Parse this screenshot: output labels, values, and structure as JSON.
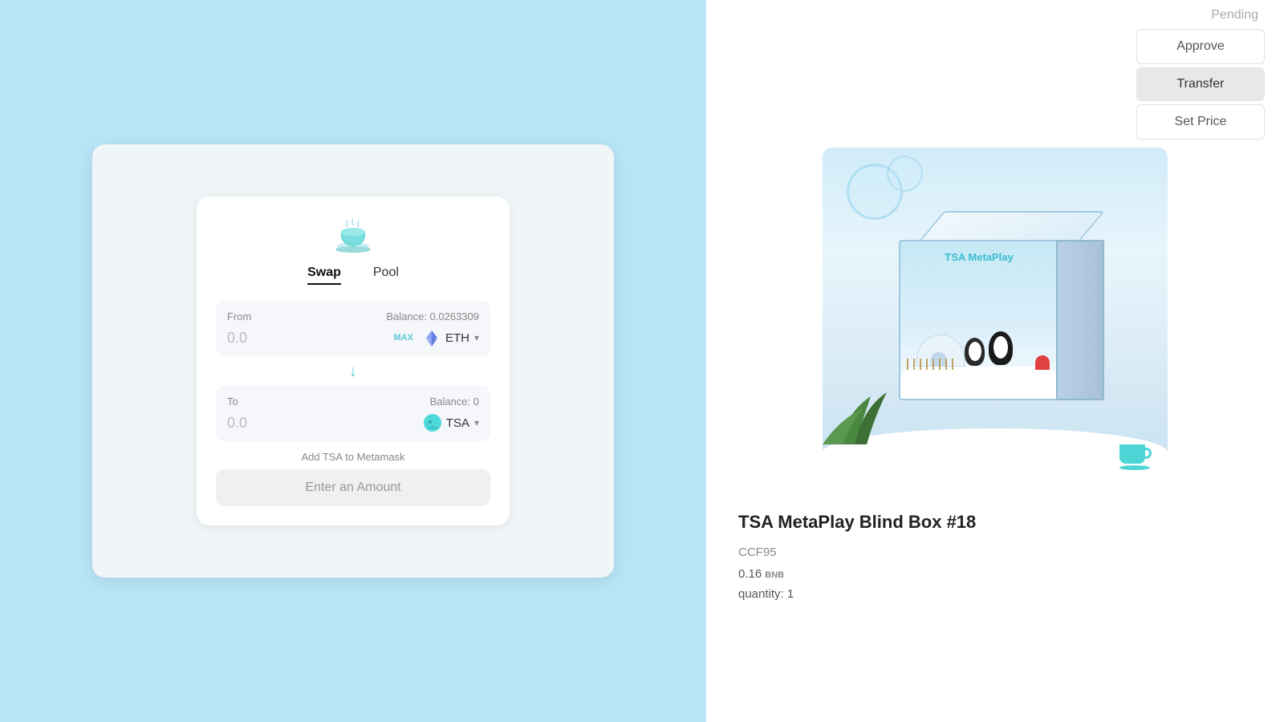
{
  "left": {
    "swap_card": {
      "tabs": [
        {
          "label": "Swap",
          "active": true
        },
        {
          "label": "Pool",
          "active": false
        }
      ],
      "from_section": {
        "label": "From",
        "balance_label": "Balance: 0.0263309",
        "amount_placeholder": "0.0",
        "max_label": "MAX",
        "token_name": "ETH"
      },
      "to_section": {
        "label": "To",
        "balance_label": "Balance: 0",
        "amount_placeholder": "0.0",
        "token_name": "TSA"
      },
      "add_metamask_label": "Add TSA to Metamask",
      "enter_amount_label": "Enter an Amount"
    }
  },
  "right": {
    "status": "Pending",
    "buttons": {
      "approve": "Approve",
      "transfer": "Transfer",
      "set_price": "Set Price"
    },
    "nft": {
      "title": "TSA MetaPlay Blind Box #18",
      "id": "CCF95",
      "price": "0.16",
      "price_unit": "BNB",
      "quantity_label": "quantity: 1",
      "box_title": "TSA MetaPlay"
    }
  }
}
